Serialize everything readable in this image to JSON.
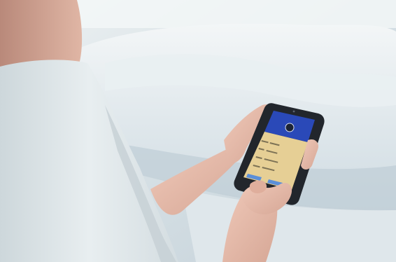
{
  "colors": {
    "background": "#dbe4e8",
    "bedding": "#e8eef1",
    "shirt": "#dfe6e8",
    "skin": "#e3b7a6",
    "phone_body": "#22262c",
    "app_header": "#2a49b8",
    "app_content": "#e6cf95",
    "app_button": "#5b8fd9"
  }
}
